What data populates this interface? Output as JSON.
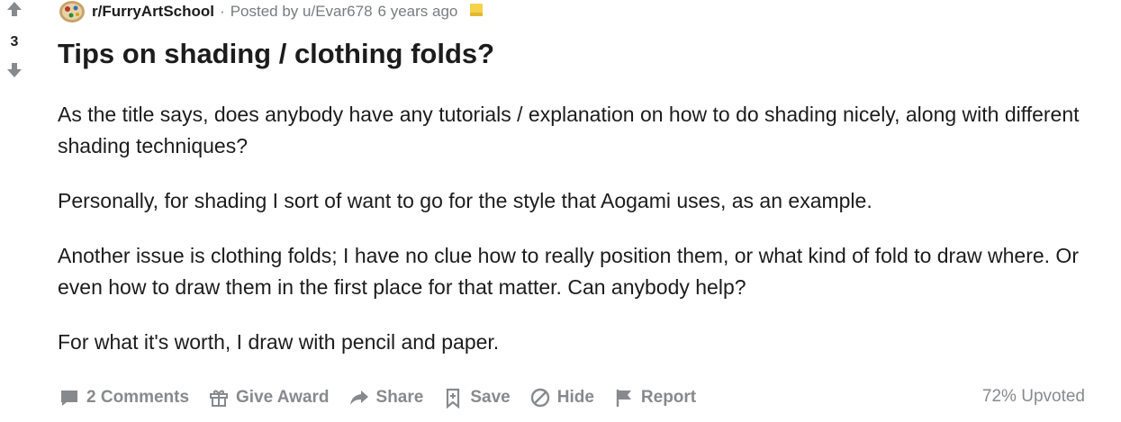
{
  "post": {
    "score": "3",
    "subreddit": "r/FurryArtSchool",
    "separator": "·",
    "posted_by": "Posted by u/Evar678",
    "time": "6 years ago",
    "title": "Tips on shading / clothing folds?",
    "paragraphs": [
      "As the title says, does anybody have any tutorials / explanation on how to do shading nicely, along with different shading techniques?",
      "Personally, for shading I sort of want to go for the style that Aogami uses, as an example.",
      "Another issue is clothing folds; I have no clue how to really position them, or what kind of fold to draw where. Or even how to draw them in the first place for that matter. Can anybody help?",
      "For what it's worth, I draw with pencil and paper."
    ]
  },
  "actions": {
    "comments": "2 Comments",
    "give_award": "Give Award",
    "share": "Share",
    "save": "Save",
    "hide": "Hide",
    "report": "Report"
  },
  "upvoted": "72% Upvoted",
  "icons": {
    "upvote": "arrow-up-icon",
    "downvote": "arrow-down-icon",
    "subreddit_avatar": "subreddit-avatar-icon",
    "award": "award-icon",
    "comments": "comment-icon",
    "gift": "gift-icon",
    "share": "share-icon",
    "save": "bookmark-icon",
    "hide": "hide-icon",
    "report": "flag-icon"
  },
  "colors": {
    "text": "#1c1c1c",
    "meta": "#787c7e",
    "actions": "#878a8c",
    "award_gold": "#f5d24a"
  }
}
